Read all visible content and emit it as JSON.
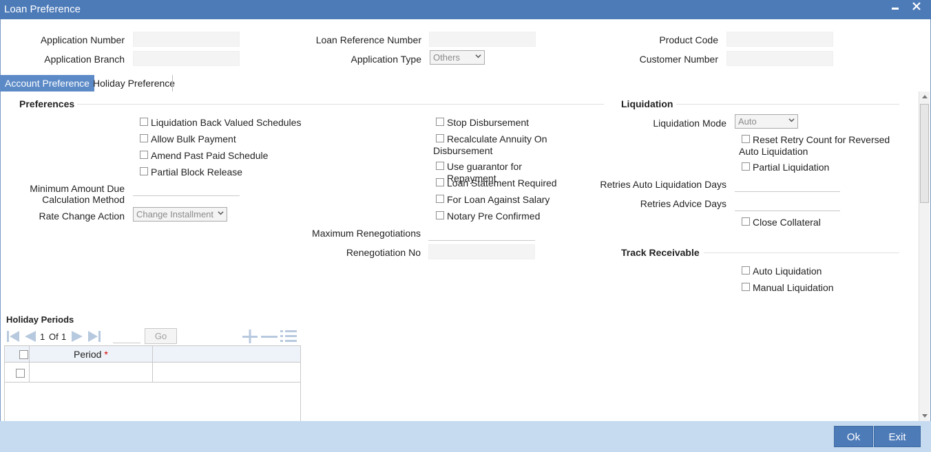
{
  "window": {
    "title": "Loan Preference"
  },
  "header": {
    "application_number_label": "Application Number",
    "application_branch_label": "Application Branch",
    "loan_reference_number_label": "Loan Reference Number",
    "application_type_label": "Application Type",
    "application_type_value": "Others",
    "product_code_label": "Product Code",
    "customer_number_label": "Customer Number"
  },
  "tabs": [
    {
      "label": "Account Preference",
      "active": true
    },
    {
      "label": "Holiday Preference",
      "active": false
    }
  ],
  "preferences": {
    "title": "Preferences",
    "checkboxes": [
      "Liquidation Back Valued Schedules",
      "Allow Bulk Payment",
      "Amend Past Paid Schedule",
      "Partial Block Release"
    ],
    "min_amount_due_label": "Minimum Amount Due Calculation Method",
    "rate_change_action_label": "Rate Change Action",
    "rate_change_action_value": "Change Installment"
  },
  "middle": {
    "checkboxes": [
      "Stop Disbursement",
      "Recalculate Annuity On Disbursement",
      "Use guarantor for Repayment",
      "Loan Statement Required",
      "For Loan Against Salary",
      "Notary Pre Confirmed"
    ],
    "max_renegotiations_label": "Maximum Renegotiations",
    "renegotiation_no_label": "Renegotiation No"
  },
  "liquidation": {
    "title": "Liquidation",
    "mode_label": "Liquidation Mode",
    "mode_value": "Auto",
    "reset_retry_label": "Reset Retry Count for Reversed Auto Liquidation",
    "partial_liquidation_label": "Partial Liquidation",
    "retries_auto_label": "Retries Auto Liquidation Days",
    "retries_advice_label": "Retries Advice Days",
    "close_collateral_label": "Close Collateral"
  },
  "track_receivable": {
    "title": "Track Receivable",
    "auto_liquidation_label": "Auto Liquidation",
    "manual_liquidation_label": "Manual Liquidation"
  },
  "holiday_periods": {
    "title": "Holiday Periods",
    "page_current": "1",
    "page_of": "Of",
    "page_total": "1",
    "go_label": "Go",
    "column_period": "Period",
    "required_mark": "*"
  },
  "footer": {
    "ok_label": "Ok",
    "exit_label": "Exit"
  },
  "colors": {
    "titlebar": "#4d7bb8",
    "tab_active": "#5b8ac7",
    "footer": "#c6dbef",
    "required": "#d40000"
  }
}
